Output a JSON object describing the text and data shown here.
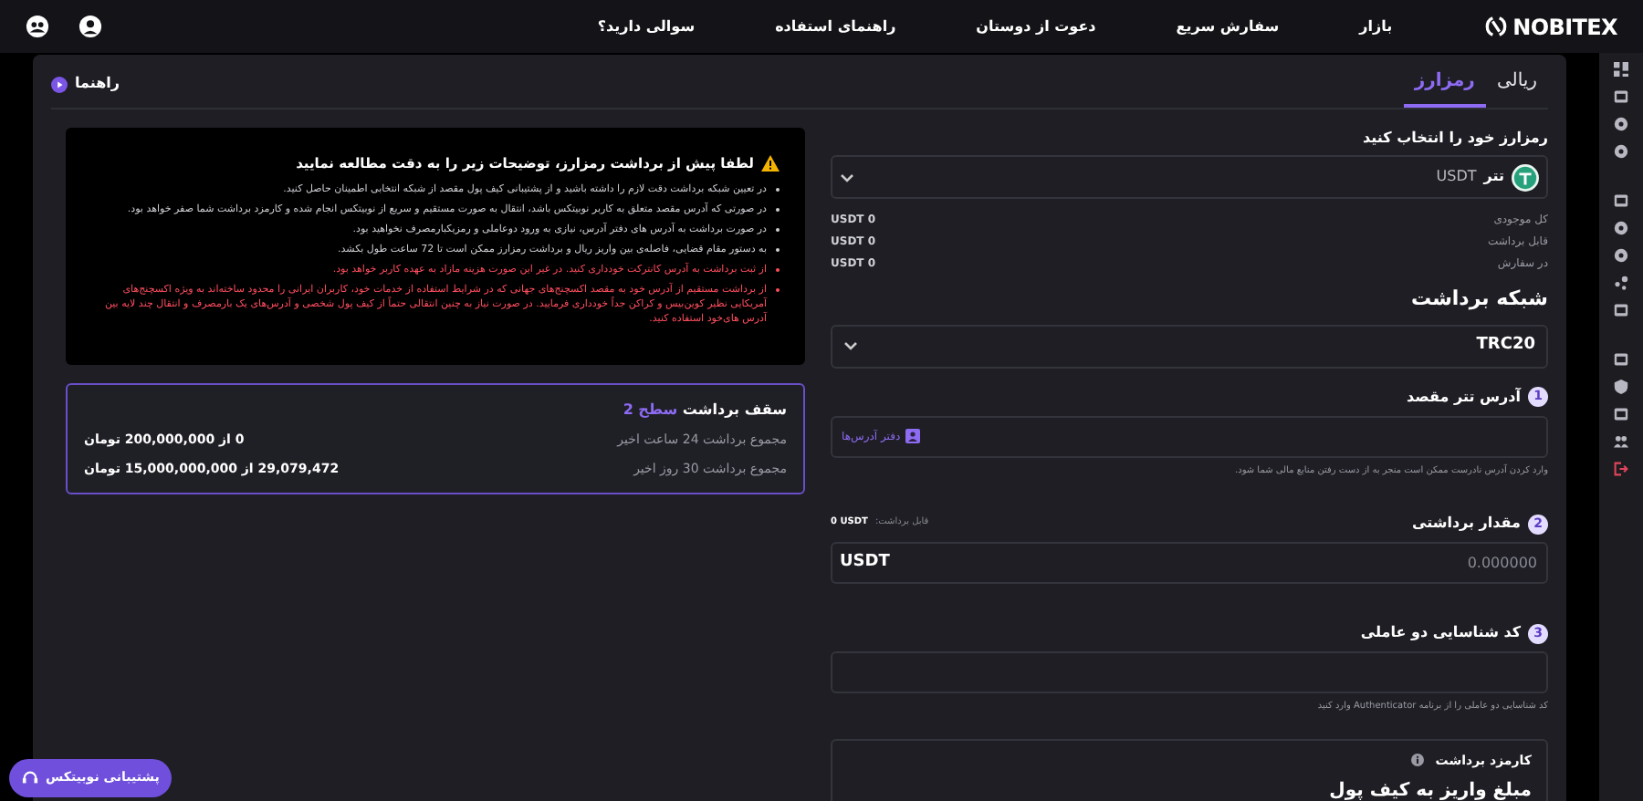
{
  "nav": {
    "logo": "NOBITEX",
    "links": [
      "بازار",
      "سفارش سریع",
      "دعوت از دوستان",
      "راهنمای استفاده",
      "سوالی دارید؟"
    ]
  },
  "tabs": [
    {
      "label": "ریالی",
      "selected": false
    },
    {
      "label": "رمزارز",
      "selected": true
    }
  ],
  "guide": "راهنما",
  "warning": {
    "title": "لطفا پیش از برداشت رمزارز، توضیحات زیر را به دقت مطالعه نمایید",
    "items": [
      {
        "text": "در تعیین شبکه برداشت دقت لازم را داشته باشید و از پشتیبانی کیف پول مقصد از شبکه انتخابی اطمینان حاصل کنید.",
        "highlighted": false
      },
      {
        "text": "در صورتی که آدرس مقصد متعلق به کاربر نوبیتکس باشد، انتقال به صورت مستقیم و سریع از نوبیتکس انجام شده و کارمزد برداشت شما صفر خواهد بود.",
        "highlighted": false
      },
      {
        "text": "در صورت برداشت به آدرس های دفتر آدرس، نیازی به ورود دوعاملی و رمزیکبارمصرف نخواهید بود.",
        "highlighted": false
      },
      {
        "text": "به دستور مقام قضایی، فاصله‌ی بین واریز ریال و برداشت رمزارز ممکن است تا 72 ساعت طول بکشد.",
        "highlighted": false
      },
      {
        "text": "از ثبت برداشت به آدرس کانترکت خودداری کنید. در غیر این صورت هزینه مازاد به عهده کاربر خواهد بود.",
        "highlighted": true
      },
      {
        "text": "از برداشت مستقیم از آدرس خود به مقصد اکسچنج‌های جهانی که در شرایط استفاده از خدمات خود، کاربران ایرانی را محدود ساخته‌اند به ویژه اکسچنج‌های آمریکایی نظیر کوین‌بیس و کراکن جداً خودداری فرمایید. در صورت نیاز به چنین انتقالی حتماً از کیف پول شخصی و آدرس‌های یک بارمصرف و انتقال چند لایه بین آدرس های‌خود استفاده کنید.",
        "highlighted": true
      }
    ]
  },
  "limits": {
    "title": "سقف برداشت",
    "level": "سطح 2",
    "rows": [
      {
        "label": "مجموع برداشت 24 ساعت اخیر",
        "value": "0 از 200,000,000 تومان"
      },
      {
        "label": "مجموع برداشت 30 روز اخیر",
        "value": "29,079,472 از 15,000,000,000 تومان"
      }
    ]
  },
  "form": {
    "coin_label": "رمزارز خود را انتخاب کنید",
    "coin": {
      "name": "تتر",
      "symbol": "USDT"
    },
    "balances": [
      {
        "label": "کل موجودی",
        "amount": "0",
        "unit": "USDT"
      },
      {
        "label": "قابل برداشت",
        "amount": "0",
        "unit": "USDT"
      },
      {
        "label": "در سفارش",
        "amount": "0",
        "unit": "USDT"
      }
    ],
    "network_label": "شبکه برداشت",
    "network": "TRC20",
    "steps": [
      {
        "number": "1",
        "label": "آدرس تتر مقصد",
        "kind": "address",
        "button": "دفتر آدرس‌ها",
        "hint": "وارد کردن آدرس نادرست ممکن است منجر به از دست رفتن منابع مالی شما شود."
      },
      {
        "number": "2",
        "label": "مقدار برداشتی",
        "kind": "amount",
        "available_label": "قابل برداشت:",
        "available": "0 USDT",
        "placeholder": "0.000000",
        "unit": "USDT"
      },
      {
        "number": "3",
        "label": "کد شناسایی دو عاملی",
        "kind": "code",
        "hint": "کد شناسایی دو عاملی را از برنامه Authenticator وارد کنید"
      }
    ],
    "fee": {
      "label": "کارمزد برداشت",
      "deposit_label": "مبلغ واریز به کیف پول"
    }
  },
  "support": "پشتیبانی نوبیتکس"
}
